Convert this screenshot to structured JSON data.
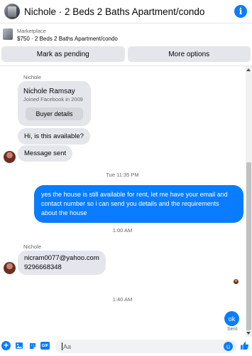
{
  "header": {
    "title": "Nichole · 2 Beds 2 Baths Apartment/condo",
    "info_icon": "i",
    "colors": {
      "accent": "#0a7cff"
    }
  },
  "listing": {
    "category": "Marketplace",
    "description": "$750 · 2 Beds 2 Baths Apartment/condo"
  },
  "actions": {
    "mark_pending": "Mark as pending",
    "more_options": "More options"
  },
  "conversation": {
    "sender_name": "Nichole",
    "profile_card": {
      "name": "Nichole Ramsay",
      "subtitle": "Joined Facebook in 2009",
      "button": "Buyer details"
    },
    "messages_in_1": [
      "Hi, is this available?",
      "Message sent"
    ],
    "timestamp_1": "Tue 11:35 PM",
    "message_out_1": "yes the house is still available for rent, let me have your email  and contact number so i can send you details and the requirements about the house",
    "timestamp_2": "1:00 AM",
    "sender_name_2": "Nichole",
    "message_in_2_line1": "nicram0077@yahoo.com",
    "message_in_2_line2": "9296668348",
    "timestamp_3": "1:40 AM",
    "message_out_2": "ok",
    "sent_status": "Sent"
  },
  "composer": {
    "placeholder": "Aa",
    "icons": [
      "plus-icon",
      "image-icon",
      "sticker-icon",
      "gif-icon",
      "emoji-icon",
      "like-icon"
    ],
    "gif_text": "GIF"
  }
}
